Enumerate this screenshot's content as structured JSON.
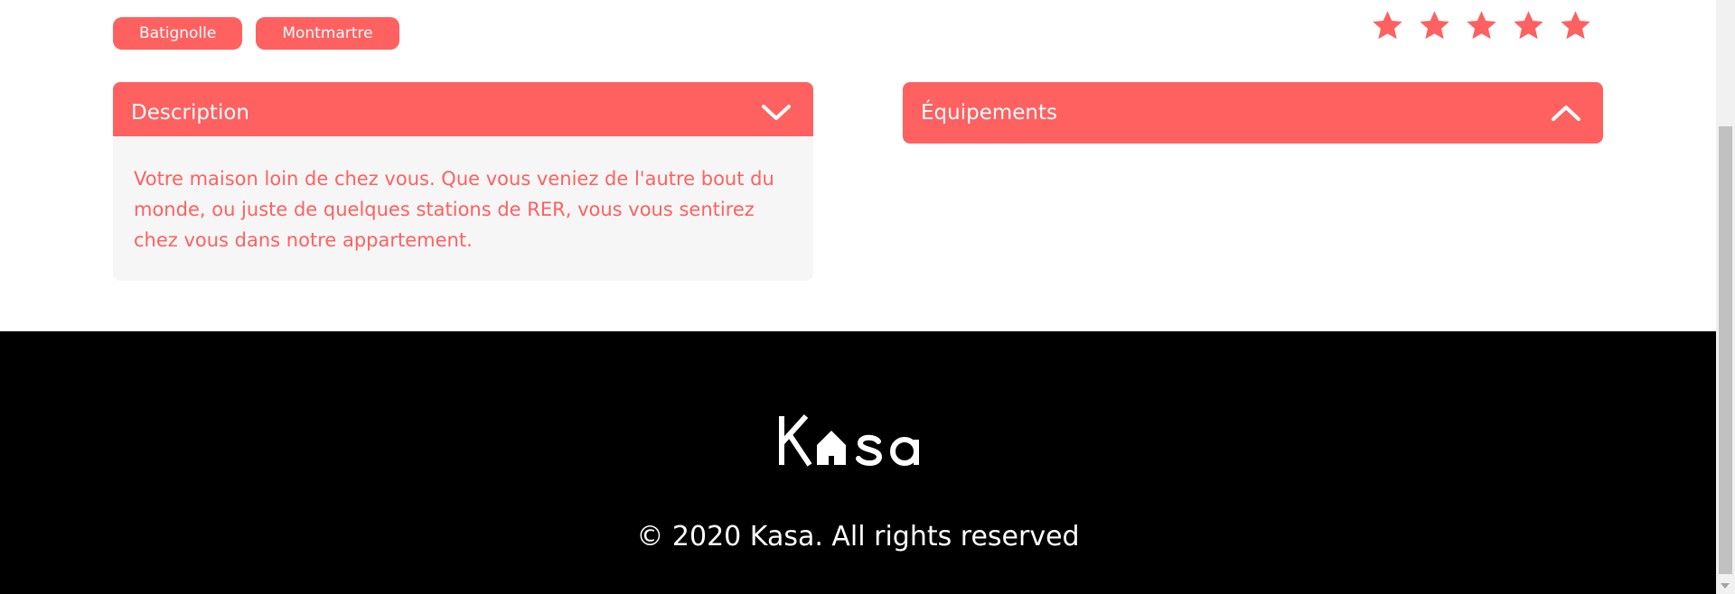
{
  "tags": [
    "Batignolle",
    "Montmartre"
  ],
  "rating": {
    "value": 5,
    "max": 5,
    "active_color": "#FF6060",
    "inactive_color": "#E3E3E3"
  },
  "collapses": [
    {
      "title": "Description",
      "open": true,
      "icon": "chevron-down-icon",
      "body": "Votre maison loin de chez vous. Que vous veniez de l'autre bout du monde, ou juste de quelques stations de RER, vous vous sentirez chez vous dans notre appartement."
    },
    {
      "title": "Équipements",
      "open": false,
      "icon": "chevron-up-icon",
      "body": ""
    }
  ],
  "footer": {
    "logo_text": "Kasa",
    "copyright": "© 2020 Kasa. All rights reserved"
  },
  "colors": {
    "accent": "#FF6060",
    "panel_bg": "#F6F6F6",
    "footer_bg": "#000000"
  }
}
